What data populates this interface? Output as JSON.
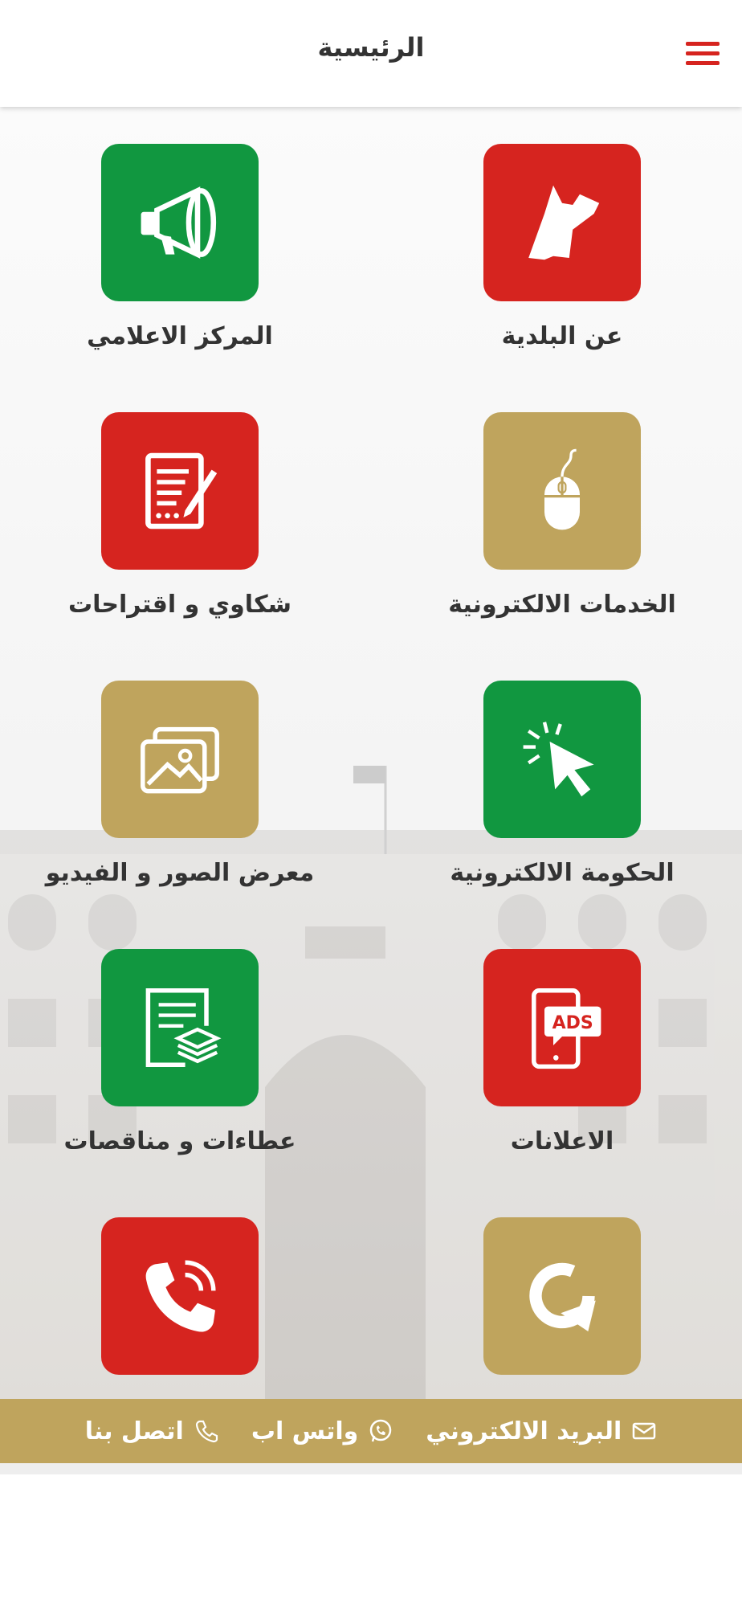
{
  "header": {
    "title": "الرئيسية",
    "menu_icon": "hamburger-menu-icon",
    "accent": "#d6241f"
  },
  "colors": {
    "green": "#119740",
    "red": "#d6241f",
    "gold": "#bfa45d"
  },
  "grid": {
    "items": [
      {
        "label": "عن البلدية",
        "icon": "jordan-map-icon",
        "color": "red"
      },
      {
        "label": "المركز الاعلامي",
        "icon": "megaphone-icon",
        "color": "green"
      },
      {
        "label": "الخدمات الالكترونية",
        "icon": "mouse-icon",
        "color": "gold"
      },
      {
        "label": "شكاوي و اقتراحات",
        "icon": "document-pen-icon",
        "color": "red"
      },
      {
        "label": "الحكومة الالكترونية",
        "icon": "cursor-click-icon",
        "color": "green"
      },
      {
        "label": "معرض الصور و الفيديو",
        "icon": "gallery-icon",
        "color": "gold"
      },
      {
        "label": "الاعلانات",
        "icon": "ads-phone-icon",
        "color": "red"
      },
      {
        "label": "عطاءات و مناقصات",
        "icon": "document-layers-icon",
        "color": "green"
      },
      {
        "label": "",
        "icon": "rotate-arrow-icon",
        "color": "gold"
      },
      {
        "label": "",
        "icon": "phone-call-icon",
        "color": "red"
      }
    ]
  },
  "footer": {
    "email_label": "البريد الالكتروني",
    "whatsapp_label": "واتس اب",
    "call_label": "اتصل بنا",
    "email_icon": "envelope-icon",
    "whatsapp_icon": "whatsapp-icon",
    "call_icon": "phone-icon"
  }
}
